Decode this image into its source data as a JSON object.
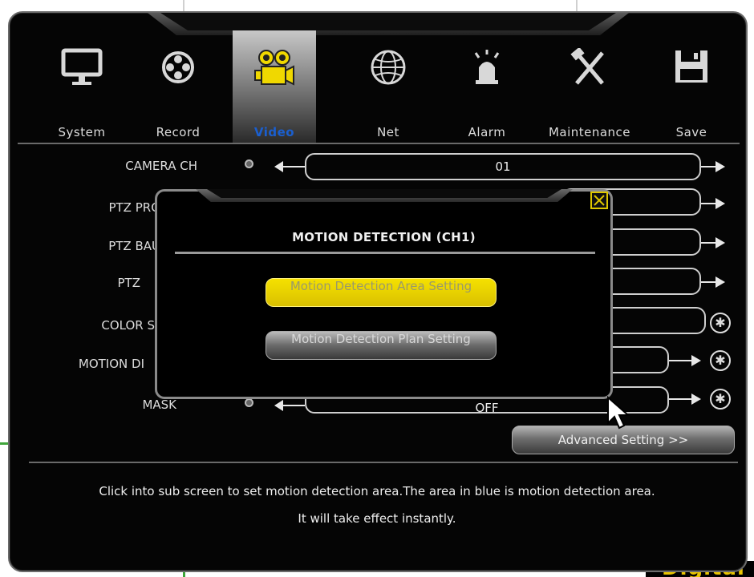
{
  "nav": {
    "items": [
      {
        "label": "System",
        "icon": "monitor-icon"
      },
      {
        "label": "Record",
        "icon": "film-reel-icon"
      },
      {
        "label": "Video",
        "icon": "video-camera-icon",
        "active": true
      },
      {
        "label": "Net",
        "icon": "globe-icon"
      },
      {
        "label": "Alarm",
        "icon": "alarm-siren-icon"
      },
      {
        "label": "Maintenance",
        "icon": "tools-icon"
      },
      {
        "label": "Save",
        "icon": "floppy-disk-icon"
      }
    ]
  },
  "settings": {
    "camera_ch": {
      "label": "CAMERA CH",
      "value": "01"
    },
    "ptz_protocol": {
      "label": "PTZ PRO"
    },
    "ptz_baud": {
      "label": "PTZ BAU"
    },
    "ptz": {
      "label": "PTZ"
    },
    "color_setting": {
      "label": "COLOR S"
    },
    "motion_detection": {
      "label": "MOTION DI"
    },
    "mask": {
      "label": "MASK",
      "value": "OFF"
    }
  },
  "advanced_button": "Advanced Setting >>",
  "hint": {
    "line1": "Click into sub screen to set motion detection area.The area in blue is motion detection area.",
    "line2": "It will take effect instantly."
  },
  "popup": {
    "title": "MOTION DETECTION  (CH1)",
    "buttons": {
      "area": "Motion Detection Area Setting",
      "plan": "Motion Detection Plan Setting"
    }
  },
  "colors": {
    "active_tab_text": "#1a5fd0",
    "highlight": "#e8d400"
  }
}
